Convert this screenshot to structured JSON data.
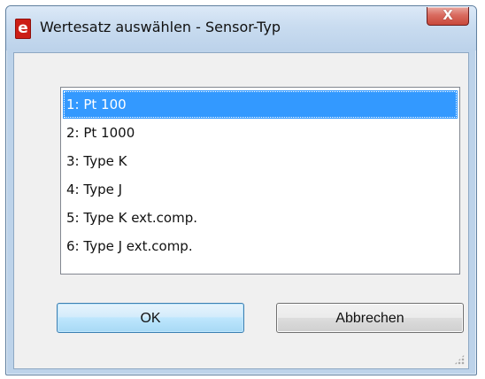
{
  "window": {
    "title": "Wertesatz auswählen - Sensor-Typ",
    "app_icon_letter": "e",
    "close_label": "X",
    "accent_color": "#3399ff"
  },
  "list": {
    "selected_index": 0,
    "items": [
      "1: Pt 100",
      "2: Pt 1000",
      "3: Type K",
      "4: Type J",
      "5: Type K ext.comp.",
      "6: Type J ext.comp."
    ]
  },
  "buttons": {
    "ok_label": "OK",
    "cancel_label": "Abbrechen"
  },
  "icons": {
    "app": "app-logo-icon",
    "close": "close-icon",
    "resize": "resize-grip-icon"
  }
}
